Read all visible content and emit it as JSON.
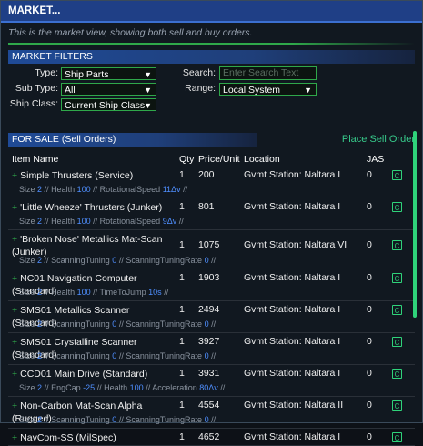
{
  "title": "MARKET...",
  "description": "This is the market view, showing both sell and buy orders.",
  "filters": {
    "header": "MARKET FILTERS",
    "type_label": "Type:",
    "type_value": "Ship Parts",
    "subtype_label": "Sub Type:",
    "subtype_value": "All",
    "shipclass_label": "Ship Class:",
    "shipclass_value": "Current Ship Class",
    "search_label": "Search:",
    "search_placeholder": "Enter Search Text",
    "range_label": "Range:",
    "range_value": "Local System"
  },
  "sale": {
    "header": "FOR SALE (Sell Orders)",
    "place_order": "Place Sell Order"
  },
  "columns": {
    "name": "Item Name",
    "qty": "Qty",
    "price": "Price/Unit",
    "location": "Location",
    "jas": "JAS"
  },
  "icons": {
    "add": "plus-icon",
    "cargo": "c-button-icon",
    "dropdown": "chevron-down-icon"
  },
  "colors": {
    "accent_green": "#2fa84a",
    "header_blue": "#1f3f86",
    "stat_value_blue": "#4f8fff"
  },
  "rows": [
    {
      "name": "Simple Thrusters (Service)",
      "qty": "1",
      "price": "200",
      "location": "Gvmt Station: Naltara I",
      "jas": "0",
      "stats": [
        {
          "label": "Size",
          "value": "2"
        },
        {
          "label": "Health",
          "value": "100"
        },
        {
          "label": "RotationalSpeed",
          "value": "11Δv"
        }
      ]
    },
    {
      "name": "'Little Wheeze' Thrusters (Junker)",
      "qty": "1",
      "price": "801",
      "location": "Gvmt Station: Naltara I",
      "jas": "0",
      "stats": [
        {
          "label": "Size",
          "value": "2"
        },
        {
          "label": "Health",
          "value": "100"
        },
        {
          "label": "RotationalSpeed",
          "value": "9Δv"
        }
      ]
    },
    {
      "name": "'Broken Nose' Metallics Mat-Scan (Junker)",
      "qty": "1",
      "price": "1075",
      "location": "Gvmt Station: Naltara VI",
      "jas": "0",
      "stats": [
        {
          "label": "Size",
          "value": "2"
        },
        {
          "label": "ScanningTuning",
          "value": "0"
        },
        {
          "label": "ScanningTuningRate",
          "value": "0"
        }
      ]
    },
    {
      "name": "NC01 Navigation Computer (Standard)",
      "qty": "1",
      "price": "1903",
      "location": "Gvmt Station: Naltara I",
      "jas": "0",
      "stats": [
        {
          "label": "Size",
          "value": "2"
        },
        {
          "label": "Health",
          "value": "100"
        },
        {
          "label": "TimeToJump",
          "value": "10s"
        }
      ]
    },
    {
      "name": "SMS01 Metallics Scanner (Standard)",
      "qty": "1",
      "price": "2494",
      "location": "Gvmt Station: Naltara I",
      "jas": "0",
      "stats": [
        {
          "label": "Size",
          "value": "2"
        },
        {
          "label": "ScanningTuning",
          "value": "0"
        },
        {
          "label": "ScanningTuningRate",
          "value": "0"
        }
      ]
    },
    {
      "name": "SMS01 Crystalline Scanner (Standard)",
      "qty": "1",
      "price": "3927",
      "location": "Gvmt Station: Naltara I",
      "jas": "0",
      "stats": [
        {
          "label": "Size",
          "value": "2"
        },
        {
          "label": "ScanningTuning",
          "value": "0"
        },
        {
          "label": "ScanningTuningRate",
          "value": "0"
        }
      ]
    },
    {
      "name": "CCD01 Main Drive (Standard)",
      "qty": "1",
      "price": "3931",
      "location": "Gvmt Station: Naltara I",
      "jas": "0",
      "stats": [
        {
          "label": "Size",
          "value": "2"
        },
        {
          "label": "EngCap",
          "value": "-25"
        },
        {
          "label": "Health",
          "value": "100"
        },
        {
          "label": "Acceleration",
          "value": "80Δv"
        }
      ]
    },
    {
      "name": "Non-Carbon Mat-Scan Alpha (Rugged)",
      "qty": "1",
      "price": "4554",
      "location": "Gvmt Station: Naltara II",
      "jas": "0",
      "stats": [
        {
          "label": "Size",
          "value": "2"
        },
        {
          "label": "ScanningTuning",
          "value": "0"
        },
        {
          "label": "ScanningTuningRate",
          "value": "0"
        }
      ]
    },
    {
      "name": "NavCom-SS (MilSpec)",
      "qty": "1",
      "price": "4652",
      "location": "Gvmt Station: Naltara I",
      "jas": "0",
      "stats": []
    }
  ]
}
